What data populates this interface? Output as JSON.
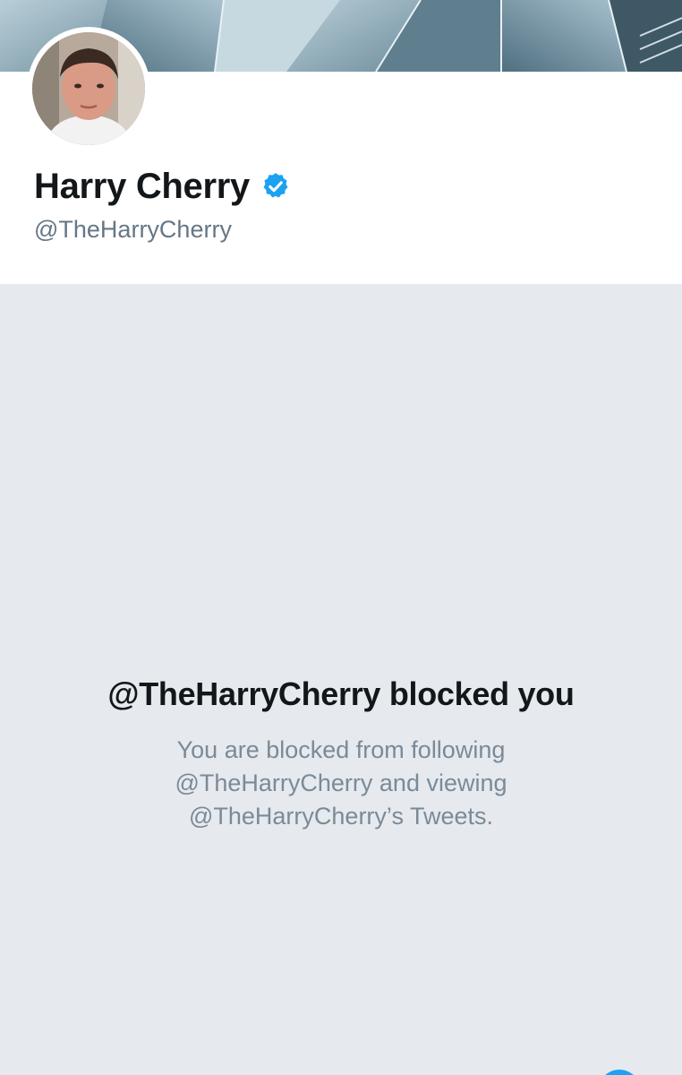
{
  "profile": {
    "display_name": "Harry Cherry",
    "handle": "@TheHarryCherry",
    "verified": true,
    "verified_icon": "verified-badge-icon"
  },
  "blocked": {
    "title": "@TheHarryCherry blocked you",
    "description": "You are blocked from following @TheHarryCherry and viewing @TheHarryCherry’s Tweets."
  },
  "colors": {
    "brand_blue": "#1da1f2",
    "text_primary": "#14171a",
    "text_secondary": "#657786",
    "panel_bg": "#e6e9ee"
  }
}
